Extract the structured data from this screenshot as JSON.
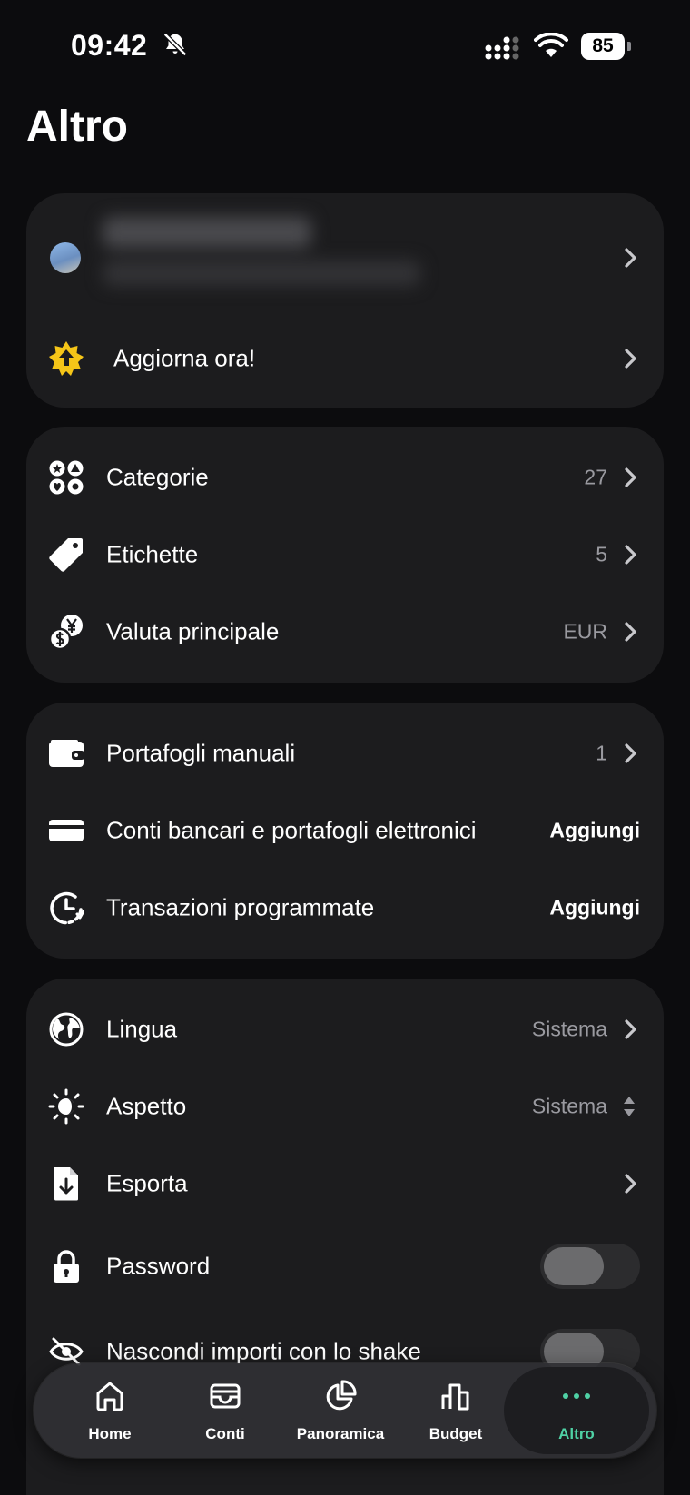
{
  "status_bar": {
    "time": "09:42",
    "battery": "85"
  },
  "page_title": "Altro",
  "account": {
    "upgrade_label": "Aggiorna ora!"
  },
  "settings_a": {
    "categories": {
      "label": "Categorie",
      "value": "27"
    },
    "tags": {
      "label": "Etichette",
      "value": "5"
    },
    "currency": {
      "label": "Valuta principale",
      "value": "EUR"
    }
  },
  "settings_b": {
    "wallets": {
      "label": "Portafogli manuali",
      "value": "1"
    },
    "banks": {
      "label": "Conti bancari e portafogli elettronici",
      "action": "Aggiungi"
    },
    "scheduled": {
      "label": "Transazioni programmate",
      "action": "Aggiungi"
    }
  },
  "settings_c": {
    "language": {
      "label": "Lingua",
      "value": "Sistema"
    },
    "appearance": {
      "label": "Aspetto",
      "value": "Sistema"
    },
    "export": {
      "label": "Esporta"
    },
    "password": {
      "label": "Password",
      "on": false
    },
    "hide_amounts": {
      "label": "Nascondi importi con lo shake",
      "on": false
    }
  },
  "tabbar": {
    "home": "Home",
    "accounts": "Conti",
    "overview": "Panoramica",
    "budget": "Budget",
    "more": "Altro"
  },
  "colors": {
    "accent": "#4fd1a5",
    "card": "#1c1c1e",
    "background": "#0c0c0e",
    "upgrade_icon": "#f5c518"
  }
}
